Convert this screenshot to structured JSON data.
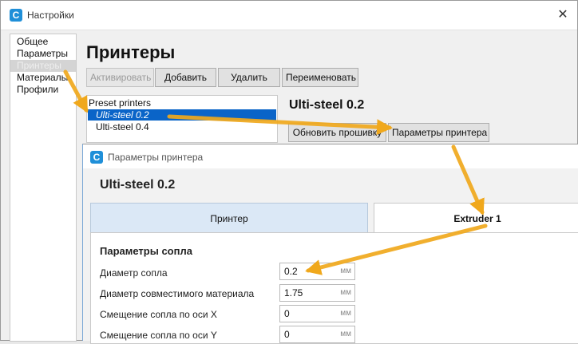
{
  "window": {
    "title": "Настройки",
    "close_icon": "close-icon",
    "brand_color": "#1f8fd8"
  },
  "app_icon_glyph": "C",
  "nav": {
    "items": [
      {
        "label": "Общее",
        "selected": false
      },
      {
        "label": "Параметры",
        "selected": false
      },
      {
        "label": "Принтеры",
        "selected": true
      },
      {
        "label": "Материалы",
        "selected": false
      },
      {
        "label": "Профили",
        "selected": false
      }
    ]
  },
  "page": {
    "title": "Принтеры"
  },
  "toolbar": {
    "activate_label": "Активировать",
    "add_label": "Добавить",
    "remove_label": "Удалить",
    "rename_label": "Переименовать"
  },
  "printer_list": {
    "group": "Preset printers",
    "items": [
      {
        "label": "Ulti-steel 0.2",
        "selected": true
      },
      {
        "label": "Ulti-steel 0.4",
        "selected": false
      }
    ],
    "selection_color": "#0a64c8"
  },
  "printer_detail": {
    "name": "Ulti-steel 0.2",
    "update_firmware_label": "Обновить прошивку",
    "printer_settings_label": "Параметры принтера"
  },
  "dialog": {
    "title": "Параметры принтера",
    "printer_name": "Ulti-steel 0.2",
    "tabs": [
      {
        "label": "Принтер",
        "active": false
      },
      {
        "label": "Extruder 1",
        "active": true
      }
    ],
    "section_title": "Параметры сопла",
    "fields": [
      {
        "label": "Диаметр сопла",
        "value": "0.2",
        "unit": "мм"
      },
      {
        "label": "Диаметр совместимого материала",
        "value": "1.75",
        "unit": "мм"
      },
      {
        "label": "Смещение сопла по оси X",
        "value": "0",
        "unit": "мм"
      },
      {
        "label": "Смещение сопла по оси Y",
        "value": "0",
        "unit": "мм"
      }
    ]
  },
  "annotation": {
    "arrow_color": "#f0a81c"
  }
}
